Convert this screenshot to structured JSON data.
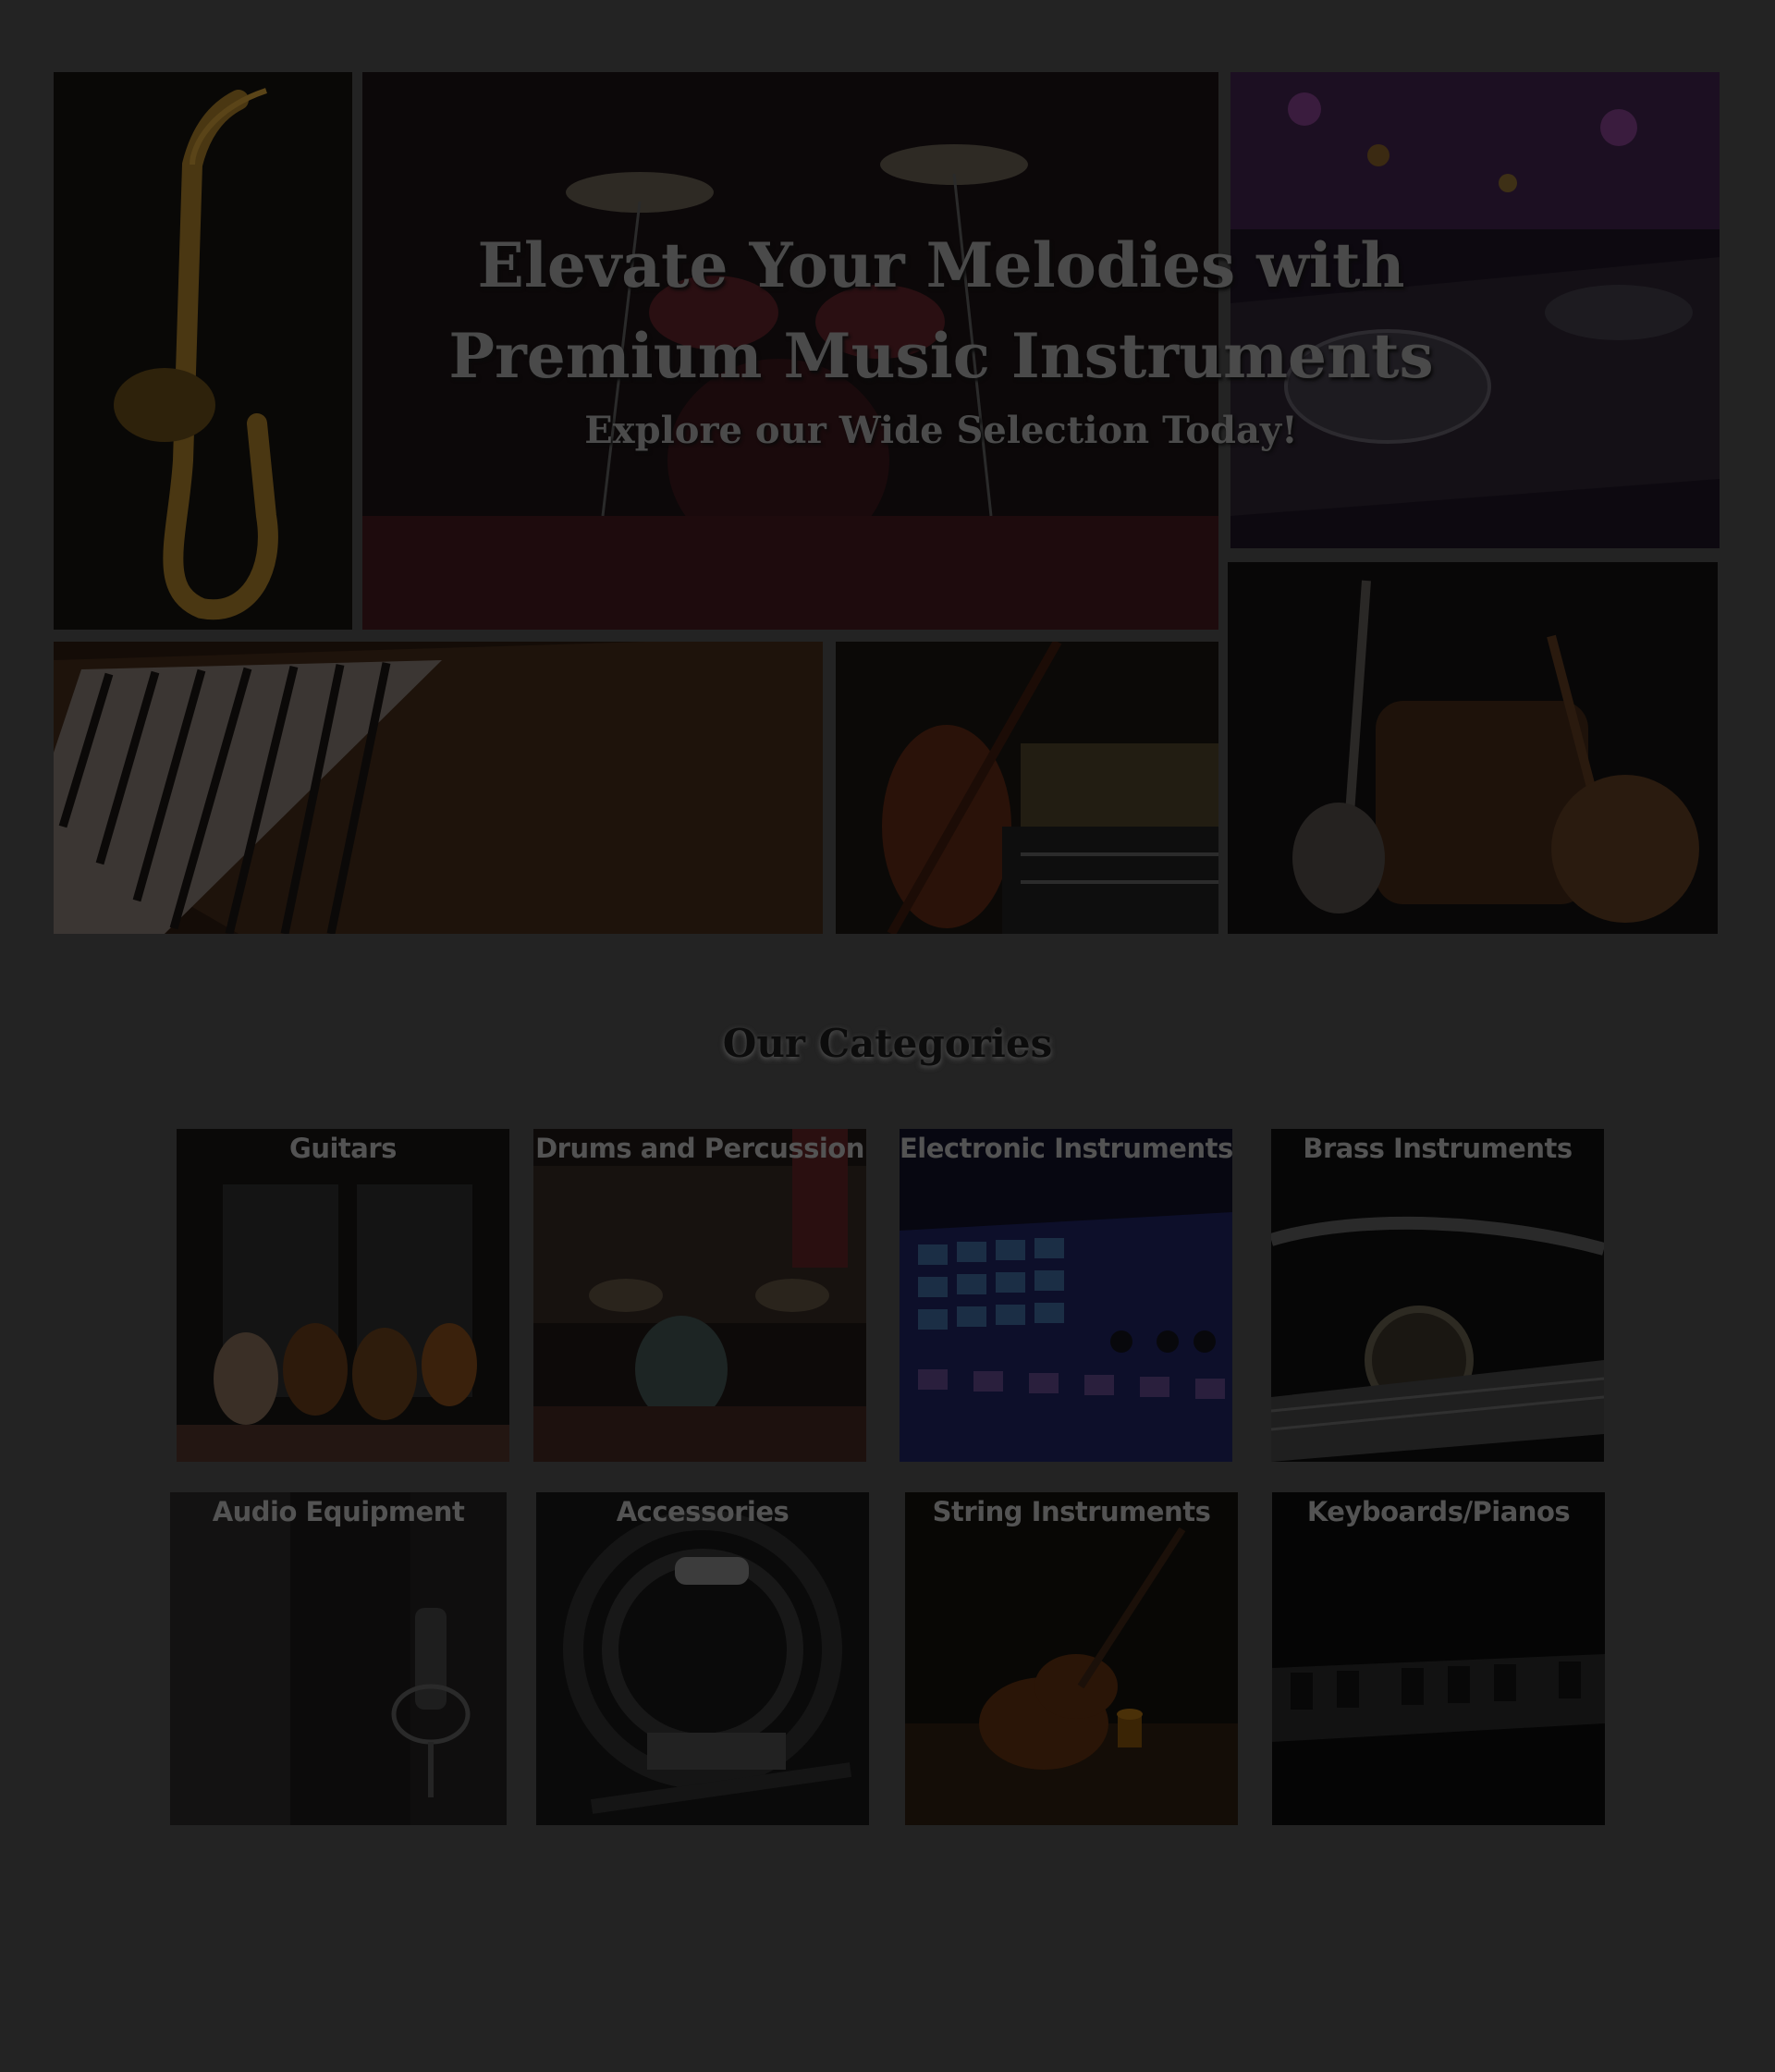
{
  "hero": {
    "title": "Elevate Your Melodies with Premium Music Instruments",
    "subtitle": "Explore our Wide Selection Today!",
    "images": [
      {
        "name": "saxophone-image"
      },
      {
        "name": "drum-kit-image"
      },
      {
        "name": "dj-controller-image"
      },
      {
        "name": "piano-keys-image"
      },
      {
        "name": "violin-image"
      },
      {
        "name": "guitars-and-drum-image"
      }
    ]
  },
  "categories": {
    "title": "Our Categories",
    "items": [
      {
        "label": "Guitars"
      },
      {
        "label": "Drums and Percussion"
      },
      {
        "label": "Electronic Instruments"
      },
      {
        "label": "Brass Instruments"
      },
      {
        "label": "Audio Equipment"
      },
      {
        "label": "Accessories"
      },
      {
        "label": "String Instruments"
      },
      {
        "label": "Keyboards/Pianos"
      }
    ]
  }
}
